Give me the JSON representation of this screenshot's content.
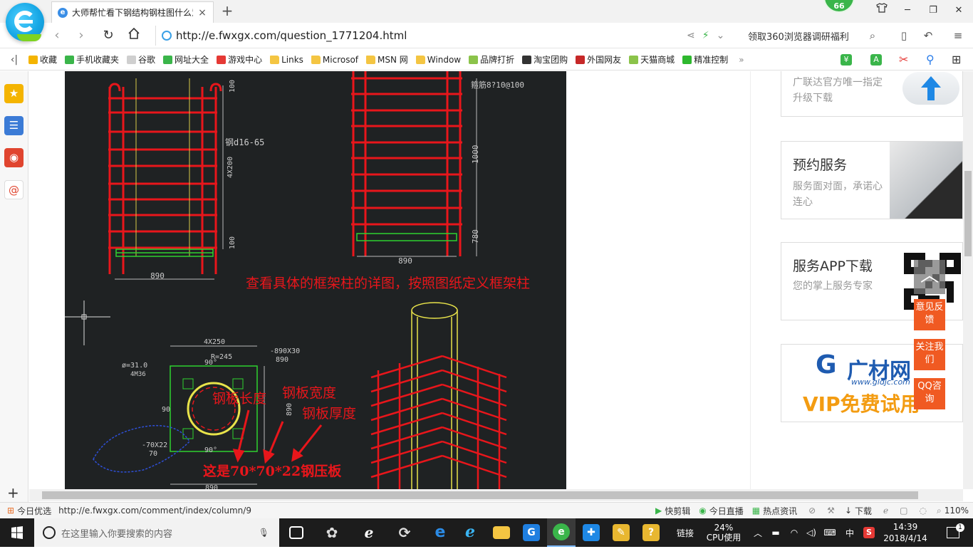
{
  "tab": {
    "title": "大师帮忙看下钢结构钢柱图什么意思",
    "favicon_letter": "e",
    "close_label": "×",
    "new_tab_label": "+"
  },
  "badge": "66",
  "window": {
    "skin_icon": "shirt-icon",
    "minimize": "─",
    "maximize": "❐",
    "close": "✕"
  },
  "address": {
    "url": "http://e.fwxgx.com/question_1771204.html",
    "promo": "领取360浏览器调研福利"
  },
  "bookmarks": [
    {
      "label": "收藏",
      "icon": "star-icon",
      "color": "#f4b400"
    },
    {
      "label": "手机收藏夹",
      "icon": "phone-icon",
      "color": "#3ab54a"
    },
    {
      "label": "谷歌",
      "icon": "page-icon",
      "color": "#cfcfcf"
    },
    {
      "label": "网址大全",
      "icon": "globe-icon",
      "color": "#3ab54a"
    },
    {
      "label": "游戏中心",
      "icon": "game-icon",
      "color": "#e53935"
    },
    {
      "label": "Links",
      "icon": "folder-icon",
      "color": "#f4c542"
    },
    {
      "label": "Microsof",
      "icon": "folder-icon",
      "color": "#f4c542"
    },
    {
      "label": "MSN 网",
      "icon": "folder-icon",
      "color": "#f4c542"
    },
    {
      "label": "Window",
      "icon": "folder-icon",
      "color": "#f4c542"
    },
    {
      "label": "品牌打折",
      "icon": "tag-icon",
      "color": "#8bc34a"
    },
    {
      "label": "淘宝团购",
      "icon": "taobao-icon",
      "color": "#333333"
    },
    {
      "label": "外国网友",
      "icon": "flag-icon",
      "color": "#c62828"
    },
    {
      "label": "天猫商城",
      "icon": "tmall-icon",
      "color": "#8bc34a"
    },
    {
      "label": "精准控制",
      "icon": "chat-icon",
      "color": "#2eb82e"
    }
  ],
  "cad": {
    "labels": {
      "d1": "100",
      "d2": "4X200",
      "d3": "100",
      "d4": "890",
      "d5": "890",
      "d6": "1000",
      "d7": "780",
      "spec1": "钢d16-65",
      "spec2": "箍筋8?10@100",
      "plate": "-890X30",
      "plate_w": "890",
      "bolt": "4M36",
      "r": "R=245",
      "dia": "ø=31.0",
      "grid": "4X250",
      "side": "-70X22",
      "side_w": "70",
      "ang1": "90°",
      "ang2": "90",
      "ang3": "90°",
      "bottom": "890",
      "vert": "890"
    },
    "annotation_main": "查看具体的框架柱的详图，按照图纸定义框架柱",
    "annotation_len": "钢板长度",
    "annotation_wid": "钢板宽度",
    "annotation_thk": "钢板厚度",
    "annotation_note": "这是70*70*22钢压板"
  },
  "ads": [
    {
      "title": "",
      "text": "广联达官方唯一指定升级下载"
    },
    {
      "title": "预约服务",
      "text": "服务面对面，承诺心连心"
    },
    {
      "title": "服务APP下载",
      "text": "您的掌上服务专家"
    },
    {
      "title": "",
      "text": "",
      "logo": "广材网",
      "logo_url": "www.gldjc.com",
      "banner": "VIP免费试用"
    }
  ],
  "float": {
    "feedback": "意见反馈",
    "follow": "关注我们",
    "qq": "QQ咨询"
  },
  "status": {
    "today": "今日优选",
    "link": "http://e.fwxgx.com/comment/index/column/9",
    "items": [
      "快剪辑",
      "今日直播",
      "热点资讯",
      "下载"
    ],
    "zoom": "110%"
  },
  "taskbar": {
    "search_placeholder": "在这里输入你要搜索的内容",
    "links": "链接",
    "cpu_pct": "24%",
    "cpu_label": "CPU使用",
    "ime": "中",
    "time": "14:39",
    "date": "2018/4/14",
    "notif": "1"
  }
}
